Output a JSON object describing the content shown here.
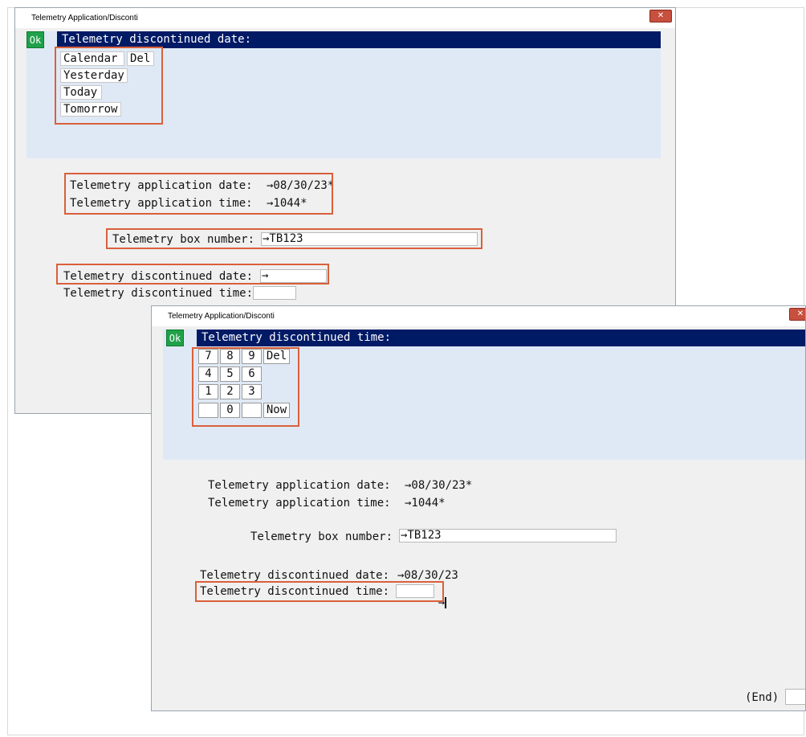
{
  "window1": {
    "title": "Telemetry Application/Disconti",
    "close_glyph": "✕",
    "ok_label": "Ok",
    "prompt": "Telemetry discontinued date:",
    "options": [
      "Calendar",
      "Yesterday",
      "Today",
      "Tomorrow"
    ],
    "del_label": "Del",
    "app_date_label": "Telemetry application date:",
    "app_date_value": "→08/30/23*",
    "app_time_label": "Telemetry application time:",
    "app_time_value": "→1044*",
    "box_label": "Telemetry box number:",
    "box_value": "→TB123",
    "disc_date_label": "Telemetry discontinued date:",
    "disc_date_value": "→",
    "disc_time_label": "Telemetry discontinued time:",
    "disc_time_value": ""
  },
  "window2": {
    "title": "Telemetry Application/Disconti",
    "close_glyph": "✕",
    "ok_label": "Ok",
    "prompt": "Telemetry discontinued time:",
    "keypad": [
      [
        "7",
        "8",
        "9"
      ],
      [
        "4",
        "5",
        "6"
      ],
      [
        "1",
        "2",
        "3"
      ],
      [
        "",
        "0",
        ""
      ]
    ],
    "del_label": "Del",
    "now_label": "Now",
    "app_date_label": "Telemetry application date:",
    "app_date_value": "→08/30/23*",
    "app_time_label": "Telemetry application time:",
    "app_time_value": "→1044*",
    "box_label": "Telemetry box number:",
    "box_value": "→TB123",
    "disc_date_label": "Telemetry discontinued date:",
    "disc_date_value": "→08/30/23",
    "disc_time_label": "Telemetry discontinued time:",
    "disc_time_value": "→",
    "end_label": "(End)"
  },
  "colors": {
    "prompt_bar": "#001a66",
    "ok_button": "#1fa14a",
    "picker_bg": "#dfe9f5",
    "highlight": "#d9603b",
    "close_button": "#c7503f"
  }
}
